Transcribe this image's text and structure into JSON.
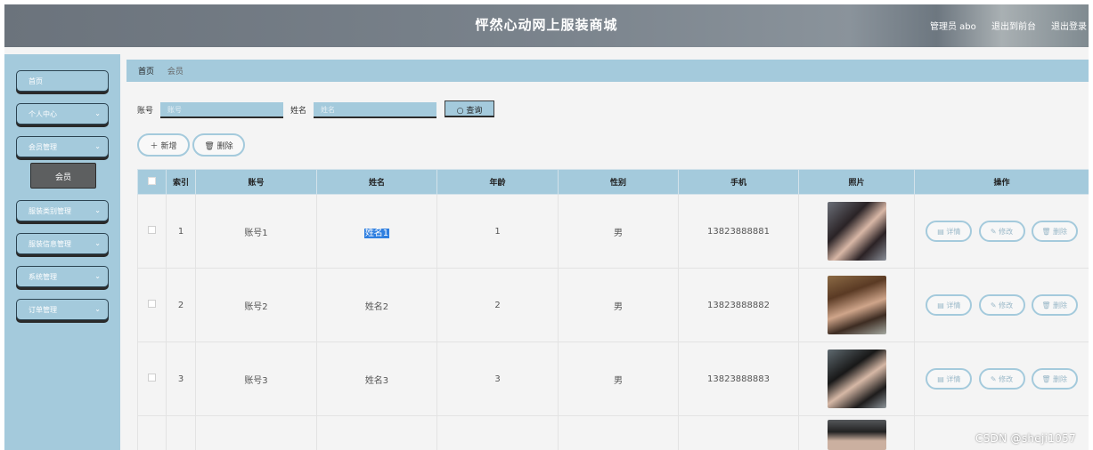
{
  "header": {
    "title": "怦然心动网上服装商城",
    "admin": "管理员 abo",
    "front": "退出到前台",
    "logout": "退出登录"
  },
  "sidebar": {
    "items": [
      {
        "label": "首页"
      },
      {
        "label": "个人中心"
      },
      {
        "label": "会员管理"
      },
      {
        "label": "会员"
      },
      {
        "label": "服装类别管理"
      },
      {
        "label": "服装信息管理"
      },
      {
        "label": "系统管理"
      },
      {
        "label": "订单管理"
      }
    ]
  },
  "breadcrumb": {
    "home": "首页",
    "current": "会员"
  },
  "search": {
    "account_label": "账号",
    "account_placeholder": "账号",
    "name_label": "姓名",
    "name_placeholder": "姓名",
    "query_label": "查询"
  },
  "actions": {
    "add_label": "新增",
    "delete_label": "删除"
  },
  "table": {
    "columns": [
      "索引",
      "账号",
      "姓名",
      "年龄",
      "性别",
      "手机",
      "照片",
      "操作"
    ],
    "rows": [
      {
        "index": "1",
        "account": "账号1",
        "name": "姓名1",
        "age": "1",
        "gender": "男",
        "phone": "13823888881"
      },
      {
        "index": "2",
        "account": "账号2",
        "name": "姓名2",
        "age": "2",
        "gender": "男",
        "phone": "13823888882"
      },
      {
        "index": "3",
        "account": "账号3",
        "name": "姓名3",
        "age": "3",
        "gender": "男",
        "phone": "13823888883"
      }
    ],
    "row_actions": {
      "detail": "详情",
      "edit": "修改",
      "delete": "删除"
    }
  },
  "watermark": "CSDN @sheji1057"
}
